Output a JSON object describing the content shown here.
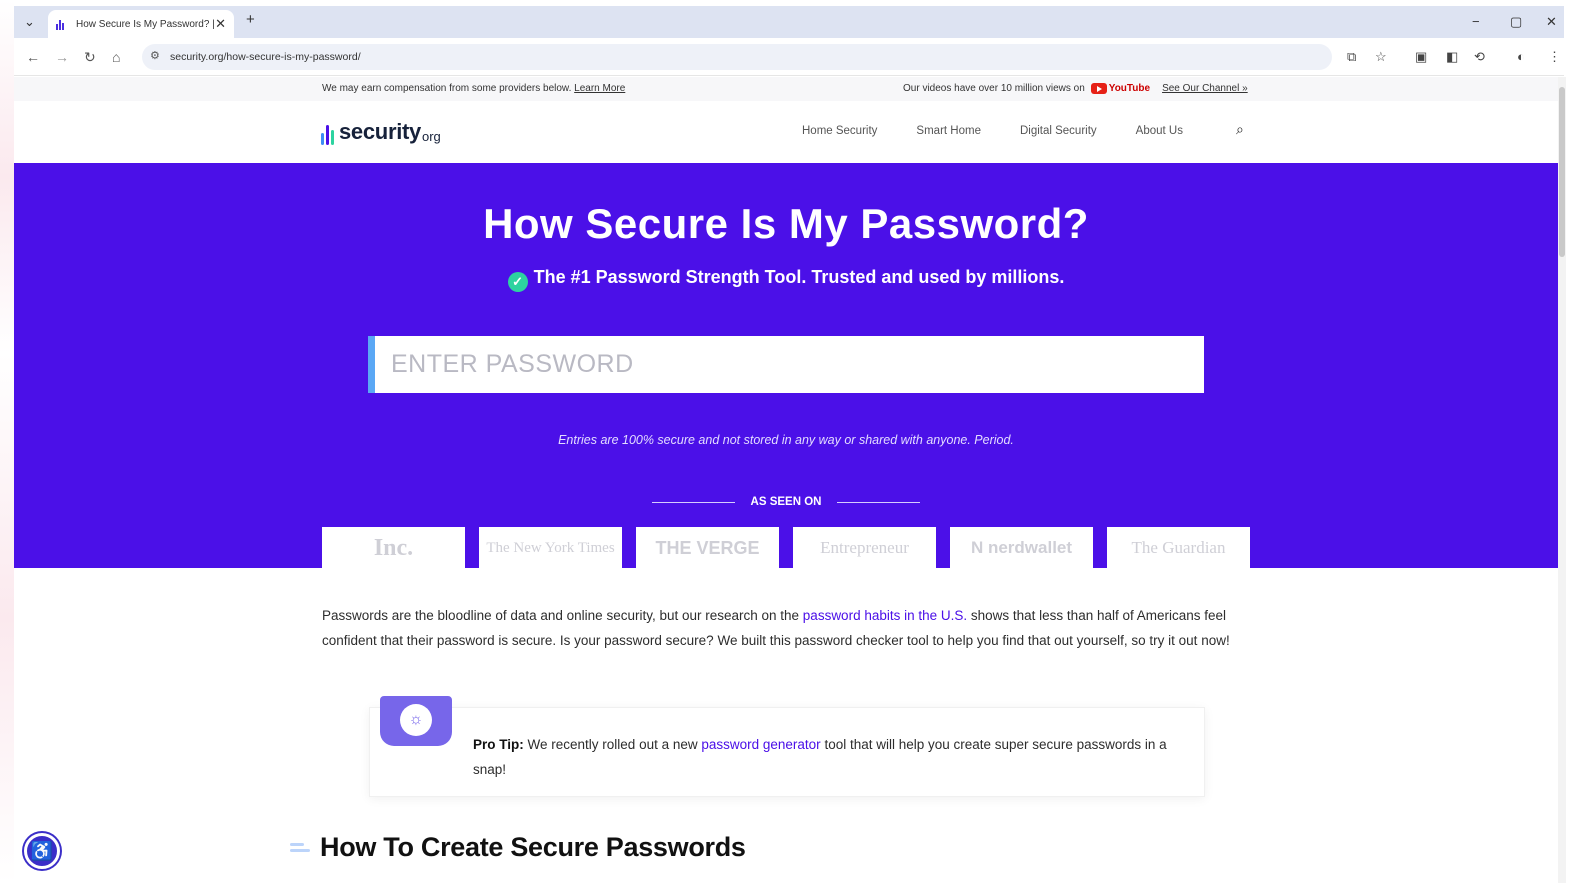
{
  "browser": {
    "tab_title": "How Secure Is My Password? |",
    "tab_close": "✕",
    "new_tab": "+",
    "tab_menu": "⌄",
    "url": "security.org/how-secure-is-my-password/",
    "window_controls": {
      "minimize": "−",
      "restore": "▢",
      "close": "✕"
    },
    "nav": {
      "back": "←",
      "forward": "→",
      "reload": "↻",
      "home": "⌂"
    },
    "toolbar_icons": {
      "translate": "⧉",
      "bookmark": "☆",
      "sidepanel": "▣",
      "extension": "◧",
      "sync": "⟲",
      "profile": "◐",
      "menu": "⋮"
    }
  },
  "topbar": {
    "disclosure": "We may earn compensation from some providers below.",
    "learn_more": "Learn More",
    "video_text": "Our videos have over 10 million views on",
    "youtube": "YouTube",
    "channel_link": "See Our Channel »"
  },
  "header": {
    "logo_name": "security",
    "logo_tld": "org",
    "nav": [
      "Home Security",
      "Smart Home",
      "Digital Security",
      "About Us"
    ],
    "search_icon": "⌕"
  },
  "hero": {
    "title": "How Secure Is My Password?",
    "check": "✓",
    "subtitle": "The #1 Password Strength Tool. Trusted and used by millions.",
    "input_placeholder": "ENTER PASSWORD",
    "disclaimer": "Entries are 100% secure and not stored in any way or shared with anyone. Period.",
    "seen_on": "AS SEEN ON",
    "press": [
      "Inc.",
      "The New York Times",
      "THE VERGE",
      "Entrepreneur",
      "N nerdwallet",
      "The Guardian"
    ]
  },
  "intro": {
    "before_link": "Passwords are the bloodline of data and online security, but our research on the ",
    "link": "password habits in the U.S.",
    "after_link": " shows that less than half of Americans feel confident that their password is secure. Is your password secure? We built this password checker tool to help you find that out yourself, so try it out now!"
  },
  "tip": {
    "icon": "💡",
    "label": "Pro Tip:",
    "before_link": " We recently rolled out a new ",
    "link": "password generator",
    "after_link": " tool that will help you create super secure passwords in a snap!"
  },
  "section": {
    "title": "How To Create Secure Passwords"
  },
  "accessibility": {
    "icon": "♿"
  },
  "colors": {
    "hero_bg": "#4b10e8",
    "accent_link": "#4b10e8",
    "check": "#2dd3a0",
    "tip_badge": "#7766ea"
  }
}
